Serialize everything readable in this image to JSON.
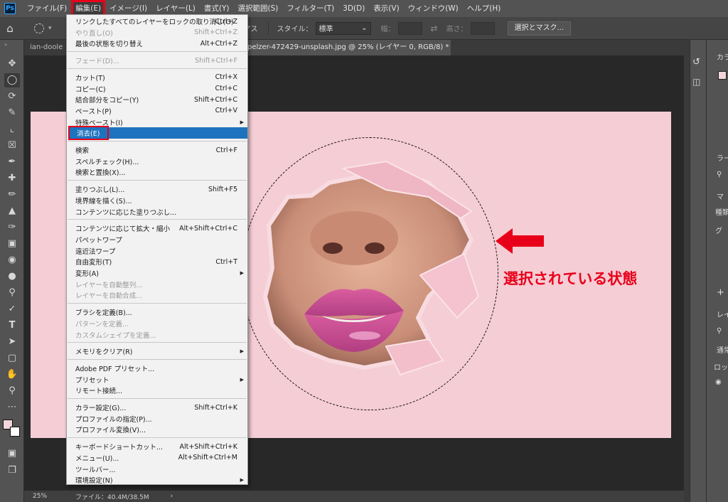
{
  "app": {
    "logo": "Ps"
  },
  "menubar": [
    {
      "label": "ファイル(F)",
      "open": false
    },
    {
      "label": "編集(E)",
      "open": true
    },
    {
      "label": "イメージ(I)",
      "open": false
    },
    {
      "label": "レイヤー(L)",
      "open": false
    },
    {
      "label": "書式(Y)",
      "open": false
    },
    {
      "label": "選択範囲(S)",
      "open": false
    },
    {
      "label": "フィルター(T)",
      "open": false
    },
    {
      "label": "3D(D)",
      "open": false
    },
    {
      "label": "表示(V)",
      "open": false
    },
    {
      "label": "ウィンドウ(W)",
      "open": false
    },
    {
      "label": "ヘルプ(H)",
      "open": false
    }
  ],
  "options": {
    "antialias_partial": "リアス",
    "style_label": "スタイル：",
    "style_value": "標準",
    "width_label": "幅：",
    "height_label": "高さ：",
    "select_mask_button": "選択とマスク..."
  },
  "tabs": [
    {
      "label": "ian-doole",
      "active": false
    },
    {
      "label": "pelzer-472429-unsplash.jpg @ 25% (レイヤー 0, RGB/8) *",
      "active": true
    }
  ],
  "tab_close": "×",
  "dropdown_items": [
    {
      "type": "item",
      "label": "リンクしたすべてのレイヤーをロックの取り消し(O)",
      "shortcut": "Ctrl+Z"
    },
    {
      "type": "item",
      "label": "やり直し(O)",
      "shortcut": "Shift+Ctrl+Z",
      "disabled": true
    },
    {
      "type": "item",
      "label": "最後の状態を切り替え",
      "shortcut": "Alt+Ctrl+Z"
    },
    {
      "type": "sep"
    },
    {
      "type": "item",
      "label": "フェード(D)...",
      "shortcut": "Shift+Ctrl+F",
      "disabled": true
    },
    {
      "type": "sep"
    },
    {
      "type": "item",
      "label": "カット(T)",
      "shortcut": "Ctrl+X"
    },
    {
      "type": "item",
      "label": "コピー(C)",
      "shortcut": "Ctrl+C"
    },
    {
      "type": "item",
      "label": "結合部分をコピー(Y)",
      "shortcut": "Shift+Ctrl+C"
    },
    {
      "type": "item",
      "label": "ペースト(P)",
      "shortcut": "Ctrl+V"
    },
    {
      "type": "item",
      "label": "特殊ペースト(I)",
      "submenu": true
    },
    {
      "type": "item",
      "label": "消去(E)",
      "highlighted": true
    },
    {
      "type": "sep"
    },
    {
      "type": "item",
      "label": "検索",
      "shortcut": "Ctrl+F"
    },
    {
      "type": "item",
      "label": "スペルチェック(H)..."
    },
    {
      "type": "item",
      "label": "検索と置換(X)..."
    },
    {
      "type": "sep"
    },
    {
      "type": "item",
      "label": "塗りつぶし(L)...",
      "shortcut": "Shift+F5"
    },
    {
      "type": "item",
      "label": "境界線を描く(S)..."
    },
    {
      "type": "item",
      "label": "コンテンツに応じた塗りつぶし..."
    },
    {
      "type": "sep"
    },
    {
      "type": "item",
      "label": "コンテンツに応じて拡大・縮小",
      "shortcut": "Alt+Shift+Ctrl+C"
    },
    {
      "type": "item",
      "label": "パペットワープ"
    },
    {
      "type": "item",
      "label": "遠近法ワープ"
    },
    {
      "type": "item",
      "label": "自由変形(T)",
      "shortcut": "Ctrl+T"
    },
    {
      "type": "item",
      "label": "変形(A)",
      "submenu": true
    },
    {
      "type": "item",
      "label": "レイヤーを自動整列...",
      "disabled": true
    },
    {
      "type": "item",
      "label": "レイヤーを自動合成...",
      "disabled": true
    },
    {
      "type": "sep"
    },
    {
      "type": "item",
      "label": "ブラシを定義(B)..."
    },
    {
      "type": "item",
      "label": "パターンを定義...",
      "disabled": true
    },
    {
      "type": "item",
      "label": "カスタムシェイプを定義...",
      "disabled": true
    },
    {
      "type": "sep"
    },
    {
      "type": "item",
      "label": "メモリをクリア(R)",
      "submenu": true
    },
    {
      "type": "sep"
    },
    {
      "type": "item",
      "label": "Adobe PDF プリセット..."
    },
    {
      "type": "item",
      "label": "プリセット",
      "submenu": true
    },
    {
      "type": "item",
      "label": "リモート接続..."
    },
    {
      "type": "sep"
    },
    {
      "type": "item",
      "label": "カラー設定(G)...",
      "shortcut": "Shift+Ctrl+K"
    },
    {
      "type": "item",
      "label": "プロファイルの指定(P)..."
    },
    {
      "type": "item",
      "label": "プロファイル変換(V)..."
    },
    {
      "type": "sep"
    },
    {
      "type": "item",
      "label": "キーボードショートカット...",
      "shortcut": "Alt+Shift+Ctrl+K"
    },
    {
      "type": "item",
      "label": "メニュー(U)...",
      "shortcut": "Alt+Shift+Ctrl+M"
    },
    {
      "type": "item",
      "label": "ツールバー..."
    },
    {
      "type": "item",
      "label": "環境設定(N)",
      "submenu": true
    }
  ],
  "annotation": {
    "text": "選択されている状態"
  },
  "status": {
    "zoom": "25%",
    "file": "ファイル：40.4M/38.5M"
  },
  "right_panel": {
    "color_tab": "カラ",
    "lib_tab": "ラー",
    "layers_tab": "レイ",
    "kind_label": "種類",
    "normal_label": "通常",
    "lock_label": "ロック",
    "group_label": "グ",
    "mode_label": "マ"
  },
  "colors": {
    "accent_red": "#e8001a",
    "highlight_blue": "#1e73be",
    "canvas_pink": "#f5cdd5"
  }
}
